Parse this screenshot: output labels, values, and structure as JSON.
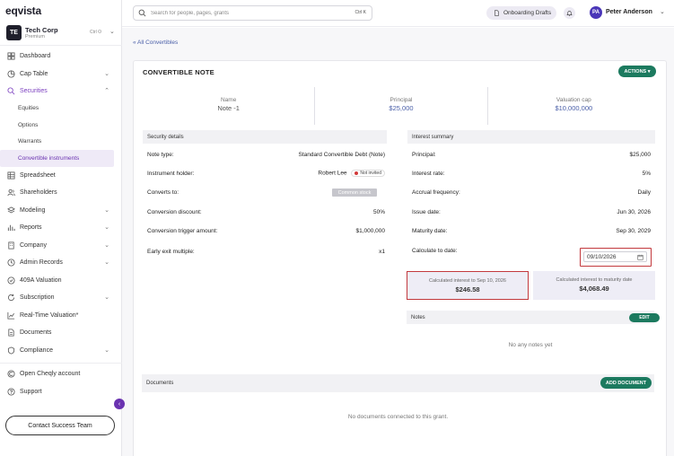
{
  "app": {
    "logo": "eqvista"
  },
  "company": {
    "initials": "TE",
    "name": "Tech Corp",
    "plan": "Premium",
    "shortcut": "Ctrl O"
  },
  "sidebar": {
    "items": [
      {
        "label": "Dashboard",
        "icon": "dashboard-icon"
      },
      {
        "label": "Cap Table",
        "icon": "pie-chart-icon",
        "chevron": "⌄"
      },
      {
        "label": "Securities",
        "icon": "securities-icon",
        "chevron": "⌃"
      },
      {
        "label": "Spreadsheet",
        "icon": "grid-icon"
      },
      {
        "label": "Shareholders",
        "icon": "users-icon"
      },
      {
        "label": "Modeling",
        "icon": "layers-icon",
        "chevron": "⌄"
      },
      {
        "label": "Reports",
        "icon": "reports-icon",
        "chevron": "⌄"
      },
      {
        "label": "Company",
        "icon": "building-icon",
        "chevron": "⌄"
      },
      {
        "label": "Admin Records",
        "icon": "records-icon",
        "chevron": "⌄"
      },
      {
        "label": "409A Valuation",
        "icon": "valuation-icon"
      },
      {
        "label": "Subscription",
        "icon": "subscription-icon",
        "chevron": "⌄"
      },
      {
        "label": "Real-Time Valuation*",
        "icon": "trend-icon"
      },
      {
        "label": "Documents",
        "icon": "document-icon"
      },
      {
        "label": "Compliance",
        "icon": "shield-icon",
        "chevron": "⌄"
      },
      {
        "label": "Open Cheqly account",
        "icon": "bank-icon"
      },
      {
        "label": "Support",
        "icon": "help-icon"
      }
    ],
    "sub_items": [
      "Equities",
      "Options",
      "Warrants",
      "Convertible instruments"
    ],
    "contact_label": "Contact Success Team",
    "collapse_glyph": "‹"
  },
  "topbar": {
    "search_placeholder": "Search for people, pages, grants",
    "search_shortcut": "Ctrl K",
    "drafts_label": "Onboarding Drafts",
    "user_initials": "PA",
    "user_name": "Peter Anderson",
    "user_chevron": "⌄"
  },
  "main": {
    "back_link": "« All Convertibles",
    "card_title": "CONVERTIBLE NOTE",
    "actions_label": "ACTIONS ▾",
    "summary": [
      {
        "label": "Name",
        "value": "Note -1"
      },
      {
        "label": "Principal",
        "value": "$25,000"
      },
      {
        "label": "Valuation cap",
        "value": "$10,000,000"
      }
    ],
    "security_details": {
      "heading": "Security details",
      "rows": [
        {
          "label": "Note type:",
          "value": "Standard Convertible Debt (Note)"
        },
        {
          "label": "Instrument holder:",
          "value": "Robert Lee",
          "badge": "Not invited"
        },
        {
          "label": "Converts to:",
          "value": "Common stock"
        },
        {
          "label": "Conversion discount:",
          "value": "50%"
        },
        {
          "label": "Conversion trigger amount:",
          "value": "$1,000,000"
        },
        {
          "label": "Early exit multiple:",
          "value": "x1"
        }
      ]
    },
    "interest_summary": {
      "heading": "Interest summary",
      "rows": [
        {
          "label": "Principal:",
          "value": "$25,000"
        },
        {
          "label": "Interest rate:",
          "value": "5%"
        },
        {
          "label": "Accrual frequency:",
          "value": "Daily"
        },
        {
          "label": "Issue date:",
          "value": "Jun 30, 2026"
        },
        {
          "label": "Maturity date:",
          "value": "Sep 30, 2029"
        }
      ],
      "calc_label": "Calculate to date:",
      "calc_date": "09/10/2026",
      "interest_to_date_label": "Calculated interest to Sep 10, 2026",
      "interest_to_date_value": "$246.58",
      "interest_to_maturity_label": "Calculated interest to maturity date",
      "interest_to_maturity_value": "$4,068.49"
    },
    "notes": {
      "heading": "Notes",
      "edit_label": "EDIT",
      "empty": "No any notes yet"
    },
    "documents": {
      "heading": "Documents",
      "add_label": "ADD DOCUMENT",
      "empty": "No documents connected to this grant."
    }
  }
}
